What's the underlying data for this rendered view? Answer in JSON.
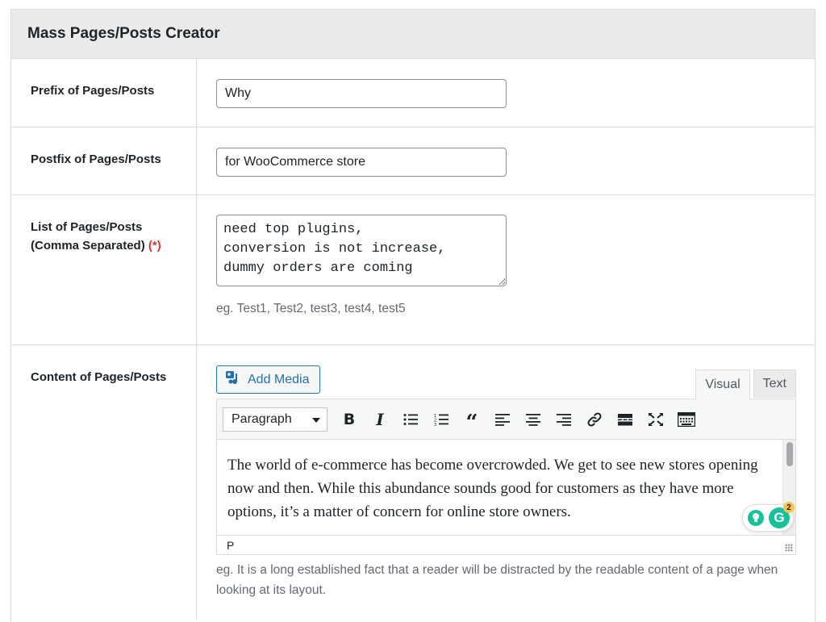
{
  "panel": {
    "title": "Mass Pages/Posts Creator"
  },
  "fields": {
    "prefix": {
      "label": "Prefix of Pages/Posts",
      "value": "Why"
    },
    "postfix": {
      "label": "Postfix of Pages/Posts",
      "value": "for WooCommerce store"
    },
    "list": {
      "label": "List of Pages/Posts",
      "label_line2": "(Comma Separated)",
      "required_mark": "(*)",
      "value": "need top plugins,\nconversion is not increase,\ndummy orders are coming",
      "hint": "eg. Test1, Test2, test3, test4, test5"
    },
    "content": {
      "label": "Content of Pages/Posts",
      "hint": "eg. It is a long established fact that a reader will be distracted by the readable content of a page when looking at its layout."
    }
  },
  "editor": {
    "add_media_label": "Add Media",
    "tabs": {
      "visual": "Visual",
      "text": "Text"
    },
    "format_select": "Paragraph",
    "toolbar_icons": [
      "bold-icon",
      "italic-icon",
      "bullet-list-icon",
      "numbered-list-icon",
      "blockquote-icon",
      "align-left-icon",
      "align-center-icon",
      "align-right-icon",
      "link-icon",
      "read-more-icon",
      "fullscreen-icon",
      "toolbar-toggle-icon"
    ],
    "content": "The world of e-commerce has become overcrowded. We get to see new stores opening now and then. While this abundance sounds good for customers as they have more options, it’s a matter of concern for online store owners.",
    "status_path": "P",
    "grammarly_count": "2"
  },
  "colors": {
    "accent": "#2271b1",
    "required": "#d63638",
    "grammarly": "#15c39a",
    "header_bg": "#ebebeb"
  }
}
